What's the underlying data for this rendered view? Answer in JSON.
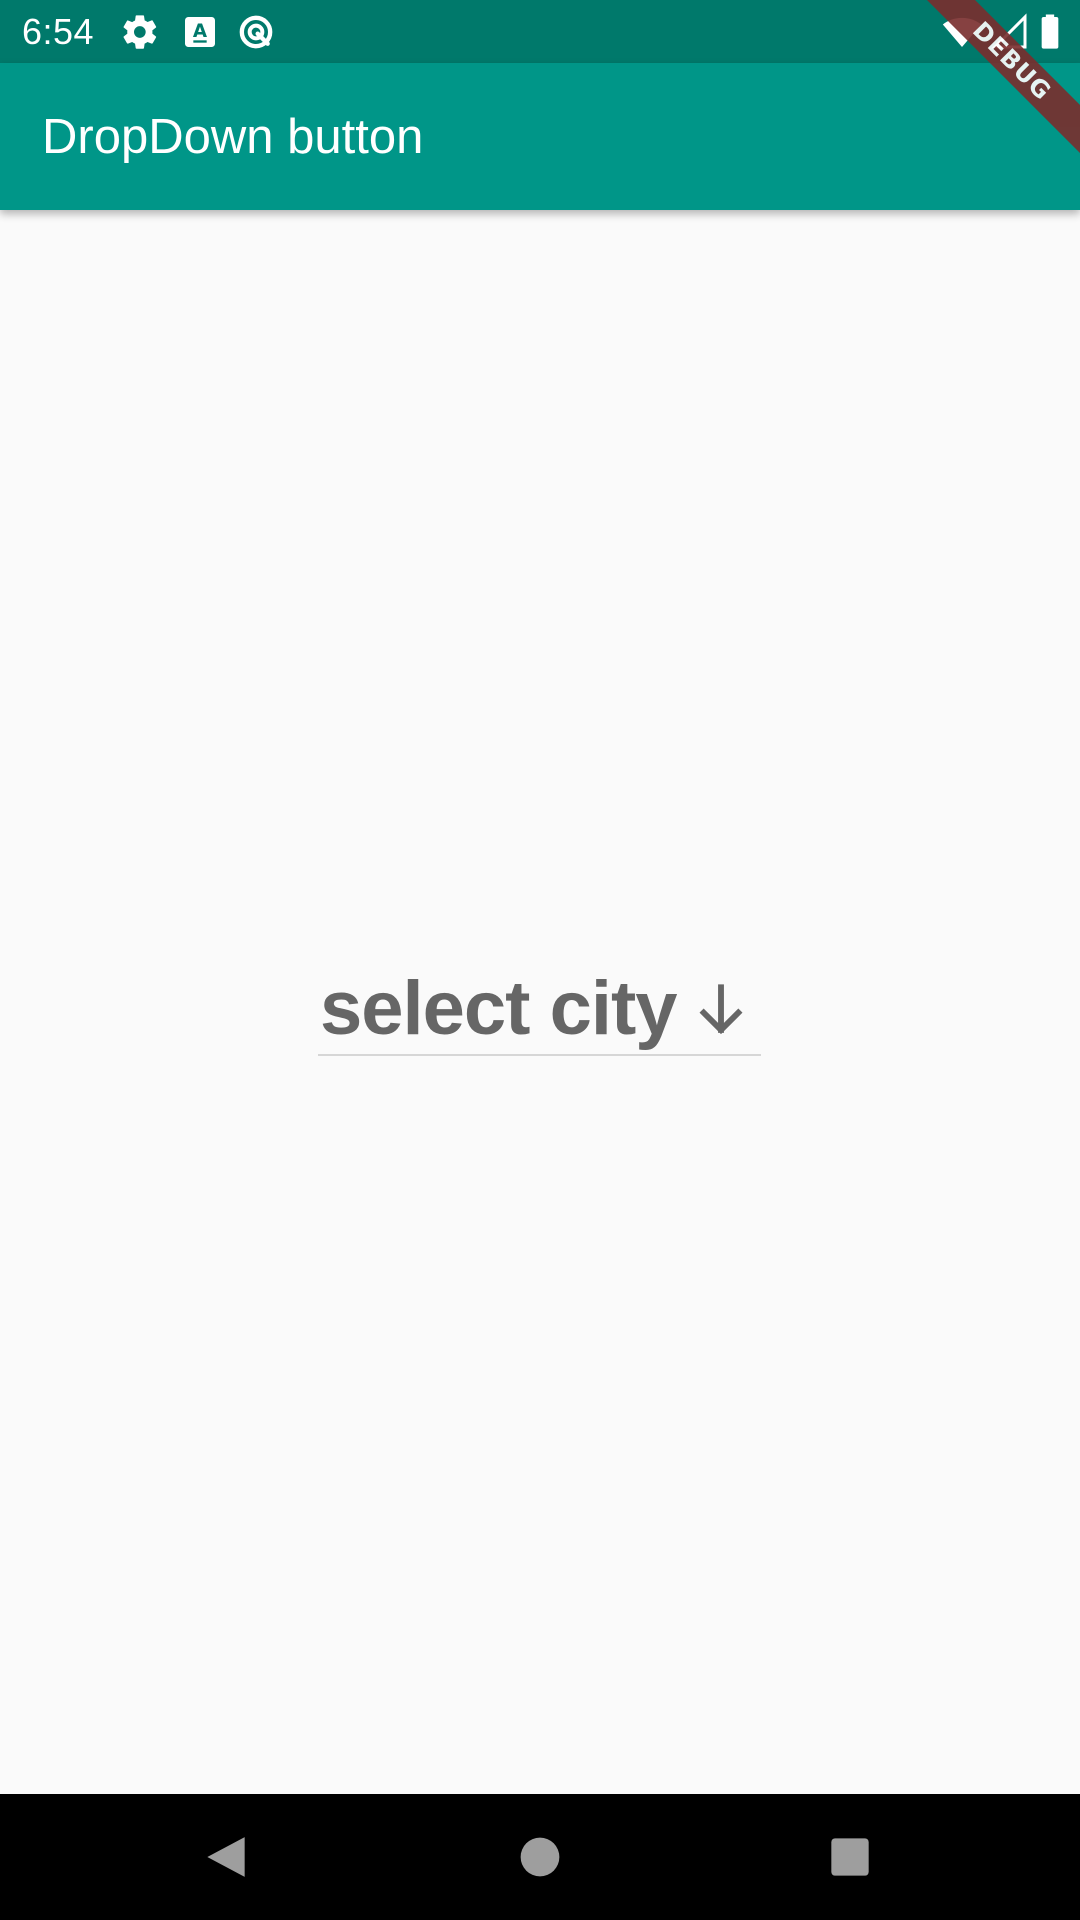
{
  "status_bar": {
    "time": "6:54",
    "icons": [
      "gear-icon",
      "text-a-icon",
      "sync-icon",
      "wifi-icon",
      "signal-icon",
      "battery-icon"
    ]
  },
  "app_bar": {
    "title": "DropDown button",
    "color": "#009688"
  },
  "debug_banner": {
    "label": "DEBUG"
  },
  "dropdown": {
    "value": "select city",
    "icon": "arrow-down-icon"
  },
  "nav_bar": {
    "buttons": [
      "back-icon",
      "home-icon",
      "recents-icon"
    ]
  },
  "colors": {
    "status_bar": "#00796b",
    "app_bar": "#009688",
    "background": "#fafafa",
    "dropdown_text": "#666666"
  }
}
